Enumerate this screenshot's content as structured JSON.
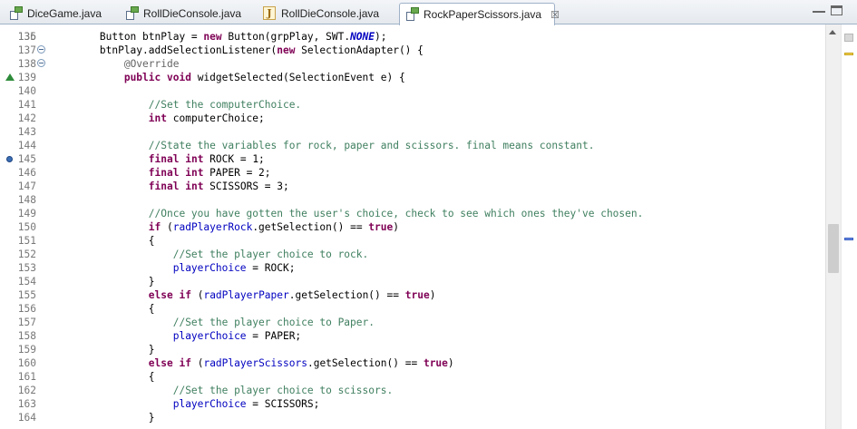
{
  "tabs": [
    {
      "label": "DiceGame.java",
      "icon": "java-file-icon"
    },
    {
      "label": "RollDieConsole.java",
      "icon": "java-file-icon"
    },
    {
      "label": "RollDieConsole.java",
      "icon": "java-class-icon"
    },
    {
      "label": "RockPaperScissors.java",
      "icon": "java-file-icon",
      "active": true,
      "close": "☒"
    }
  ],
  "editor": {
    "first_line_partial": "135",
    "lines": [
      {
        "num": "136",
        "code": [
          [
            "",
            "        Button btnPlay = "
          ],
          [
            "kw",
            "new"
          ],
          [
            "",
            " Button(grpPlay, SWT."
          ],
          [
            "cst",
            "NONE"
          ],
          [
            "",
            ");"
          ]
        ]
      },
      {
        "num": "137",
        "fold": true,
        "code": [
          [
            "",
            "        btnPlay.addSelectionListener("
          ],
          [
            "kw",
            "new"
          ],
          [
            "",
            " SelectionAdapter() {"
          ]
        ]
      },
      {
        "num": "138",
        "fold": true,
        "code": [
          [
            "",
            "            "
          ],
          [
            "ann",
            "@Override"
          ]
        ]
      },
      {
        "num": "139",
        "override": true,
        "code": [
          [
            "",
            "            "
          ],
          [
            "kw",
            "public"
          ],
          [
            "",
            " "
          ],
          [
            "kw",
            "void"
          ],
          [
            "",
            " widgetSelected(SelectionEvent e) {"
          ]
        ]
      },
      {
        "num": "140",
        "code": []
      },
      {
        "num": "141",
        "code": [
          [
            "",
            "                "
          ],
          [
            "cm",
            "//Set the computerChoice."
          ]
        ]
      },
      {
        "num": "142",
        "code": [
          [
            "",
            "                "
          ],
          [
            "kw",
            "int"
          ],
          [
            "",
            " computerChoice;"
          ]
        ]
      },
      {
        "num": "143",
        "code": []
      },
      {
        "num": "144",
        "code": [
          [
            "",
            "                "
          ],
          [
            "cm",
            "//State the variables for rock, paper and scissors. final means constant."
          ]
        ]
      },
      {
        "num": "145",
        "breakpoint": true,
        "code": [
          [
            "",
            "                "
          ],
          [
            "kw",
            "final"
          ],
          [
            "",
            " "
          ],
          [
            "kw",
            "int"
          ],
          [
            "",
            " ROCK = 1;"
          ]
        ]
      },
      {
        "num": "146",
        "code": [
          [
            "",
            "                "
          ],
          [
            "kw",
            "final"
          ],
          [
            "",
            " "
          ],
          [
            "kw",
            "int"
          ],
          [
            "",
            " PAPER = 2;"
          ]
        ]
      },
      {
        "num": "147",
        "code": [
          [
            "",
            "                "
          ],
          [
            "kw",
            "final"
          ],
          [
            "",
            " "
          ],
          [
            "kw",
            "int"
          ],
          [
            "",
            " SCISSORS = 3;"
          ]
        ]
      },
      {
        "num": "148",
        "code": []
      },
      {
        "num": "149",
        "code": [
          [
            "",
            "                "
          ],
          [
            "cm",
            "//Once you have gotten the user's choice, check to see which ones they've chosen."
          ]
        ]
      },
      {
        "num": "150",
        "code": [
          [
            "",
            "                "
          ],
          [
            "kw",
            "if"
          ],
          [
            "",
            " ("
          ],
          [
            "fld",
            "radPlayerRock"
          ],
          [
            "",
            ".getSelection() == "
          ],
          [
            "kw",
            "true"
          ],
          [
            "",
            ")"
          ]
        ]
      },
      {
        "num": "151",
        "code": [
          [
            "",
            "                {"
          ]
        ]
      },
      {
        "num": "152",
        "code": [
          [
            "",
            "                    "
          ],
          [
            "cm",
            "//Set the player choice to rock."
          ]
        ]
      },
      {
        "num": "153",
        "code": [
          [
            "",
            "                    "
          ],
          [
            "fld",
            "playerChoice"
          ],
          [
            "",
            " = ROCK;"
          ]
        ]
      },
      {
        "num": "154",
        "code": [
          [
            "",
            "                }"
          ]
        ]
      },
      {
        "num": "155",
        "code": [
          [
            "",
            "                "
          ],
          [
            "kw",
            "else"
          ],
          [
            "",
            " "
          ],
          [
            "kw",
            "if"
          ],
          [
            "",
            " ("
          ],
          [
            "fld",
            "radPlayerPaper"
          ],
          [
            "",
            ".getSelection() == "
          ],
          [
            "kw",
            "true"
          ],
          [
            "",
            ")"
          ]
        ]
      },
      {
        "num": "156",
        "code": [
          [
            "",
            "                {"
          ]
        ]
      },
      {
        "num": "157",
        "code": [
          [
            "",
            "                    "
          ],
          [
            "cm",
            "//Set the player choice to Paper."
          ]
        ]
      },
      {
        "num": "158",
        "code": [
          [
            "",
            "                    "
          ],
          [
            "fld",
            "playerChoice"
          ],
          [
            "",
            " = PAPER;"
          ]
        ]
      },
      {
        "num": "159",
        "code": [
          [
            "",
            "                }"
          ]
        ]
      },
      {
        "num": "160",
        "code": [
          [
            "",
            "                "
          ],
          [
            "kw",
            "else"
          ],
          [
            "",
            " "
          ],
          [
            "kw",
            "if"
          ],
          [
            "",
            " ("
          ],
          [
            "fld",
            "radPlayerScissors"
          ],
          [
            "",
            ".getSelection() == "
          ],
          [
            "kw",
            "true"
          ],
          [
            "",
            ")"
          ]
        ]
      },
      {
        "num": "161",
        "code": [
          [
            "",
            "                {"
          ]
        ]
      },
      {
        "num": "162",
        "code": [
          [
            "",
            "                    "
          ],
          [
            "cm",
            "//Set the player choice to scissors."
          ]
        ]
      },
      {
        "num": "163",
        "code": [
          [
            "",
            "                    "
          ],
          [
            "fld",
            "playerChoice"
          ],
          [
            "",
            " = SCISSORS;"
          ]
        ]
      },
      {
        "num": "164",
        "code": [
          [
            "",
            "                }"
          ]
        ]
      }
    ]
  },
  "colors": {
    "keyword": "#7f0055",
    "comment": "#3f7f5f",
    "field": "#0000c0",
    "annotation": "#646464",
    "line_number": "#787878"
  }
}
